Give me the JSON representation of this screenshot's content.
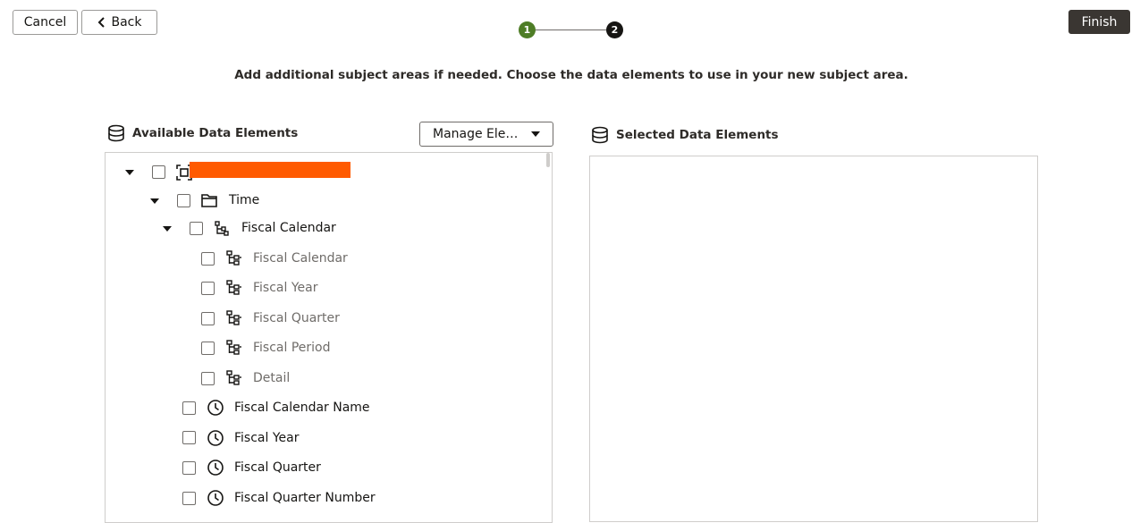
{
  "header": {
    "cancel_label": "Cancel",
    "back_label": "Back",
    "finish_label": "Finish",
    "steps": [
      "1",
      "2"
    ]
  },
  "instructions": "Add additional subject areas if needed. Choose the data elements to use in your new subject area.",
  "available": {
    "title": "Available Data Elements",
    "manage_label": "Manage Ele…",
    "tree": [
      {
        "label": "",
        "icon": "subject-area-icon",
        "expanded": true,
        "muted": false
      },
      {
        "label": "Time",
        "icon": "folder-icon",
        "expanded": true,
        "muted": false
      },
      {
        "label": "Fiscal Calendar",
        "icon": "hierarchy-icon",
        "expanded": true,
        "muted": false
      },
      {
        "label": "Fiscal Calendar",
        "icon": "hierarchy-level-icon",
        "expanded": false,
        "muted": true
      },
      {
        "label": "Fiscal Year",
        "icon": "hierarchy-level-icon",
        "expanded": false,
        "muted": true
      },
      {
        "label": "Fiscal Quarter",
        "icon": "hierarchy-level-icon",
        "expanded": false,
        "muted": true
      },
      {
        "label": "Fiscal Period",
        "icon": "hierarchy-level-icon",
        "expanded": false,
        "muted": true
      },
      {
        "label": "Detail",
        "icon": "hierarchy-level-icon",
        "expanded": false,
        "muted": true
      },
      {
        "label": "Fiscal Calendar Name",
        "icon": "clock-icon",
        "expanded": false,
        "muted": false
      },
      {
        "label": "Fiscal Year",
        "icon": "clock-icon",
        "expanded": false,
        "muted": false
      },
      {
        "label": "Fiscal Quarter",
        "icon": "clock-icon",
        "expanded": false,
        "muted": false
      },
      {
        "label": "Fiscal Quarter Number",
        "icon": "clock-icon",
        "expanded": false,
        "muted": false
      }
    ]
  },
  "selected": {
    "title": "Selected Data Elements"
  },
  "colors": {
    "step_done": "#4e7d26",
    "step_current": "#161513",
    "finish_bg": "#3a3632",
    "redaction": "#ff5a00"
  }
}
